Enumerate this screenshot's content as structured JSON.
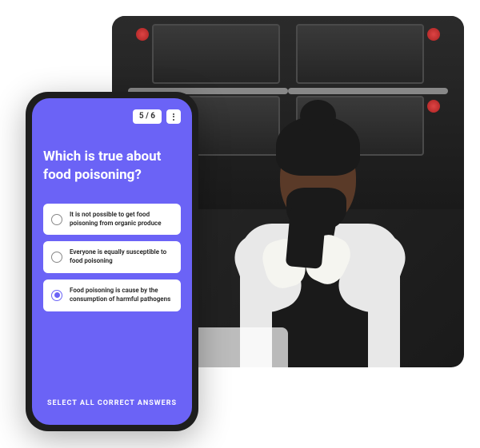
{
  "quiz": {
    "progress": "5 / 6",
    "question": "Which is true about food poisoning?",
    "options": [
      {
        "text": "It is not possible to get food poisoning from organic produce",
        "selected": false
      },
      {
        "text": "Everyone is equally susceptible to food poisoning",
        "selected": false
      },
      {
        "text": "Food poisoning is cause by the consumption of harmful pathogens",
        "selected": true
      }
    ],
    "hint": "SELECT ALL CORRECT ANSWERS"
  }
}
